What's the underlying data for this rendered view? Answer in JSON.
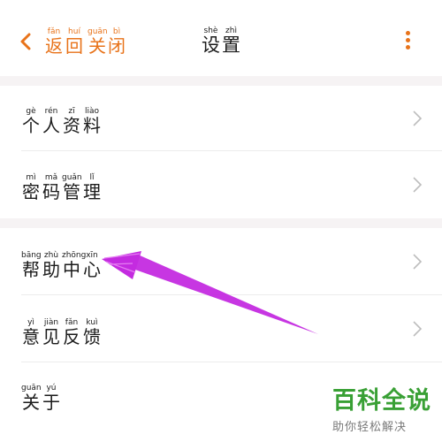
{
  "nav": {
    "back": [
      {
        "py": "fǎn",
        "hz": "返"
      },
      {
        "py": "huí",
        "hz": "回"
      }
    ],
    "close": [
      {
        "py": "guān",
        "hz": "关"
      },
      {
        "py": "bì",
        "hz": "闭"
      }
    ],
    "title": [
      {
        "py": "shè",
        "hz": "设"
      },
      {
        "py": "zhì",
        "hz": "置"
      }
    ],
    "back_icon": "chevron-left-icon",
    "more_icon": "more-vertical-icon"
  },
  "settings": {
    "profile": [
      {
        "py": "gè",
        "hz": "个"
      },
      {
        "py": "rén",
        "hz": "人"
      },
      {
        "py": "zī",
        "hz": "资"
      },
      {
        "py": "liào",
        "hz": "料"
      }
    ],
    "password": [
      {
        "py": "mì",
        "hz": "密"
      },
      {
        "py": "mǎ",
        "hz": "码"
      },
      {
        "py": "guǎn",
        "hz": "管"
      },
      {
        "py": "lǐ",
        "hz": "理"
      }
    ],
    "help": [
      {
        "py": "bāng",
        "hz": "帮"
      },
      {
        "py": "zhù",
        "hz": "助"
      },
      {
        "py": "zhōng",
        "hz": "中"
      },
      {
        "py": "xīn",
        "hz": "心"
      }
    ],
    "feedback": [
      {
        "py": "yì",
        "hz": "意"
      },
      {
        "py": "jiàn",
        "hz": "见"
      },
      {
        "py": "fǎn",
        "hz": "反"
      },
      {
        "py": "kuì",
        "hz": "馈"
      }
    ],
    "about": [
      {
        "py": "guān",
        "hz": "关"
      },
      {
        "py": "yú",
        "hz": "于"
      }
    ]
  },
  "watermark": {
    "title": "百科全说",
    "subtitle": "助你轻松解决"
  },
  "colors": {
    "accent": "#e8731a",
    "annotation": "#c42be0",
    "watermark": "#39a035"
  }
}
